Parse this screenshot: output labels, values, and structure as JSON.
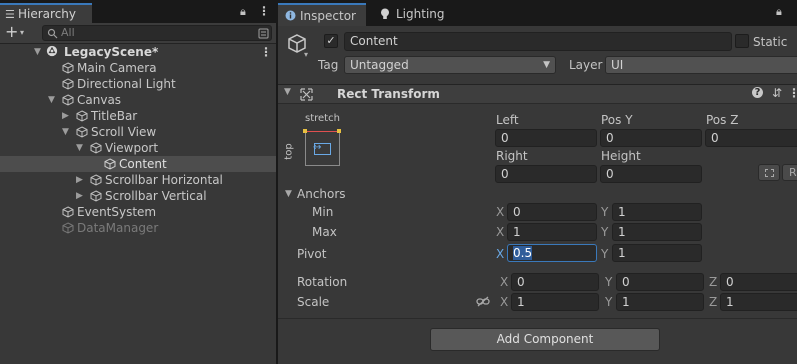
{
  "hierarchy": {
    "tab_label": "Hierarchy",
    "search_placeholder": "All",
    "scene_name": "LegacyScene*",
    "items": [
      {
        "label": "Main Camera"
      },
      {
        "label": "Directional Light"
      },
      {
        "label": "Canvas"
      },
      {
        "label": "TitleBar"
      },
      {
        "label": "Scroll View"
      },
      {
        "label": "Viewport"
      },
      {
        "label": "Content"
      },
      {
        "label": "Scrollbar Horizontal"
      },
      {
        "label": "Scrollbar Vertical"
      },
      {
        "label": "EventSystem"
      },
      {
        "label": "DataManager"
      }
    ]
  },
  "inspector": {
    "tabs": [
      {
        "label": "Inspector"
      },
      {
        "label": "Lighting"
      }
    ],
    "object_name": "Content",
    "static_label": "Static",
    "tag_label": "Tag",
    "tag_value": "Untagged",
    "layer_label": "Layer",
    "layer_value": "UI",
    "component_title": "Rect Transform",
    "anchor_preset": {
      "h": "stretch",
      "v": "top"
    },
    "fields": {
      "left_label": "Left",
      "left_value": "0",
      "posy_label": "Pos Y",
      "posy_value": "0",
      "posz_label": "Pos Z",
      "posz_value": "0",
      "right_label": "Right",
      "right_value": "0",
      "height_label": "Height",
      "height_value": "0"
    },
    "raw_button": "R",
    "anchors": {
      "label": "Anchors",
      "min_label": "Min",
      "min_x": "0",
      "min_y": "1",
      "max_label": "Max",
      "max_x": "1",
      "max_y": "1"
    },
    "pivot": {
      "label": "Pivot",
      "x": "0.5",
      "y": "1"
    },
    "rotation": {
      "label": "Rotation",
      "x": "0",
      "y": "0",
      "z": "0"
    },
    "scale": {
      "label": "Scale",
      "x": "1",
      "y": "1",
      "z": "1"
    },
    "axes": {
      "x": "X",
      "y": "Y",
      "z": "Z"
    },
    "add_component_label": "Add Component"
  },
  "colors": {
    "accent": "#3a79bb",
    "selection": "#4d4d4d",
    "panel": "#383838"
  }
}
